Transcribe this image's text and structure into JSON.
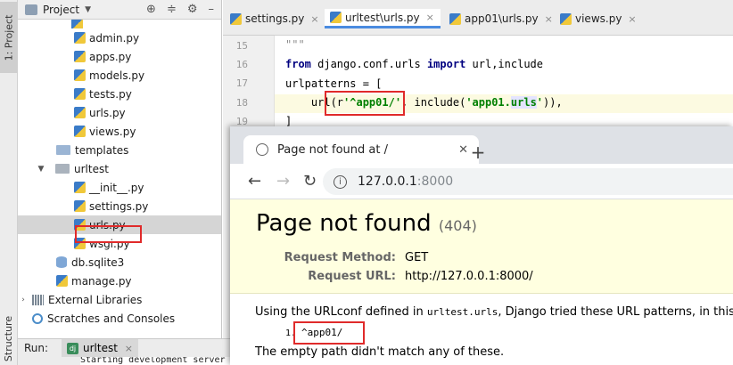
{
  "sidebar": {
    "project_tab": "1: Project",
    "structure_tab": "Structure"
  },
  "project_panel": {
    "title": "Project",
    "items": [
      {
        "label": "admin.py",
        "type": "py"
      },
      {
        "label": "apps.py",
        "type": "py"
      },
      {
        "label": "models.py",
        "type": "py"
      },
      {
        "label": "tests.py",
        "type": "py"
      },
      {
        "label": "urls.py",
        "type": "py"
      },
      {
        "label": "views.py",
        "type": "py"
      },
      {
        "label": "templates",
        "type": "folder"
      },
      {
        "label": "urltest",
        "type": "folder"
      },
      {
        "label": "__init__.py",
        "type": "py"
      },
      {
        "label": "settings.py",
        "type": "py"
      },
      {
        "label": "urls.py",
        "type": "py",
        "selected": true
      },
      {
        "label": "wsgi.py",
        "type": "py"
      },
      {
        "label": "db.sqlite3",
        "type": "db"
      },
      {
        "label": "manage.py",
        "type": "py"
      },
      {
        "label": "External Libraries",
        "type": "lib"
      },
      {
        "label": "Scratches and Consoles",
        "type": "scratch"
      }
    ]
  },
  "run": {
    "label": "Run:",
    "tab": "urltest",
    "output": "Starting development server"
  },
  "editor": {
    "tabs": [
      {
        "label": "settings.py"
      },
      {
        "label": "urltest\\urls.py",
        "active": true
      },
      {
        "label": "app01\\urls.py"
      },
      {
        "label": "views.py"
      }
    ],
    "line_numbers": [
      "15",
      "16",
      "17",
      "18",
      "19"
    ],
    "lines": {
      "l15": "\"\"\"",
      "l16_kw1": "from",
      "l16_mod": " django.conf.urls ",
      "l16_kw2": "import",
      "l16_rest": " url,include",
      "l17": "urlpatterns = [",
      "l18_pre": "    url(r",
      "l18_str": "'^app01/'",
      "l18_mid": ", include(",
      "l18_str2a": "'app01.",
      "l18_str2b": "urls",
      "l18_str2c": "'",
      "l18_end": ")),",
      "l19": "]"
    }
  },
  "browser": {
    "tab_title": "Page not found at /",
    "new_tab": "+",
    "url_host": "127.0.0.1",
    "url_port": ":8000",
    "heading": "Page not found",
    "status_code": "(404)",
    "request_method_label": "Request Method:",
    "request_method_value": "GET",
    "request_url_label": "Request URL:",
    "request_url_value": "http://127.0.0.1:8000/",
    "body_prefix": "Using the URLconf defined in ",
    "body_module": "urltest.urls",
    "body_suffix": ", Django tried these URL patterns, in this orde",
    "pattern_number": "1.",
    "pattern": "^app01/",
    "empty_path_msg": "The empty path didn't match any of these."
  }
}
